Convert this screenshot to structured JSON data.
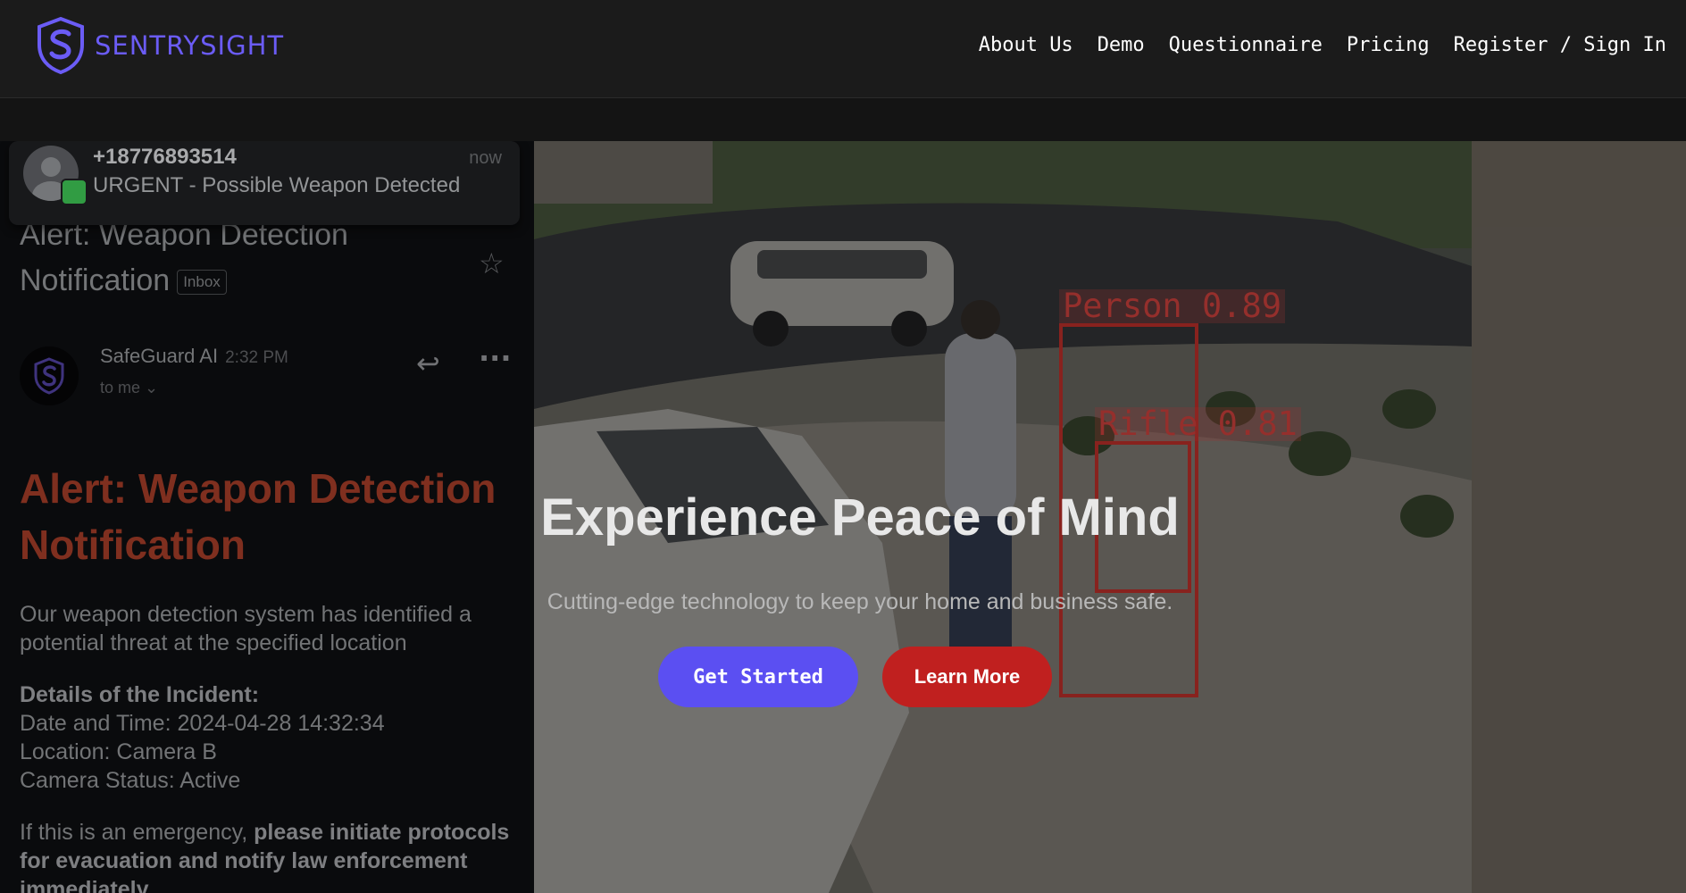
{
  "header": {
    "brand": "SENTRYSIGHT",
    "menu": [
      "About Us",
      "Demo",
      "Questionnaire",
      "Pricing",
      "Register / Sign In"
    ]
  },
  "colors": {
    "brand": "#6b5cf6",
    "primary_button": "#5b4ff2",
    "secondary_button": "#c0201f",
    "alert_title": "#9c3a26",
    "detection_box": "#a72a25"
  },
  "email": {
    "notification": {
      "number": "+18776893514",
      "message": "URGENT - Possible Weapon Detected",
      "time": "now"
    },
    "subject": "Alert: Weapon Detection Notification",
    "label": "Inbox",
    "sender": "SafeGuard AI",
    "time": "2:32 PM",
    "recipient": "to me",
    "title": "Alert: Weapon Detection Notification",
    "intro": "Our weapon detection system has identified a potential threat at the specified location",
    "details_heading": "Details of the Incident:",
    "details": [
      "Date and Time: 2024-04-28 14:32:34",
      "Location: Camera B",
      "Camera Status: Active"
    ],
    "footer_plain": "If this is an emergency, ",
    "footer_bold": "please initiate protocols for evacuation and notify law enforcement immediately"
  },
  "detections": [
    {
      "label": "Person",
      "score": "0.89"
    },
    {
      "label": "Rifle",
      "score": "0.81"
    }
  ],
  "hero": {
    "headline": "Experience Peace of Mind",
    "tagline": "Cutting-edge technology to keep your home and business safe.",
    "primary_cta": "Get Started",
    "secondary_cta": "Learn More"
  }
}
